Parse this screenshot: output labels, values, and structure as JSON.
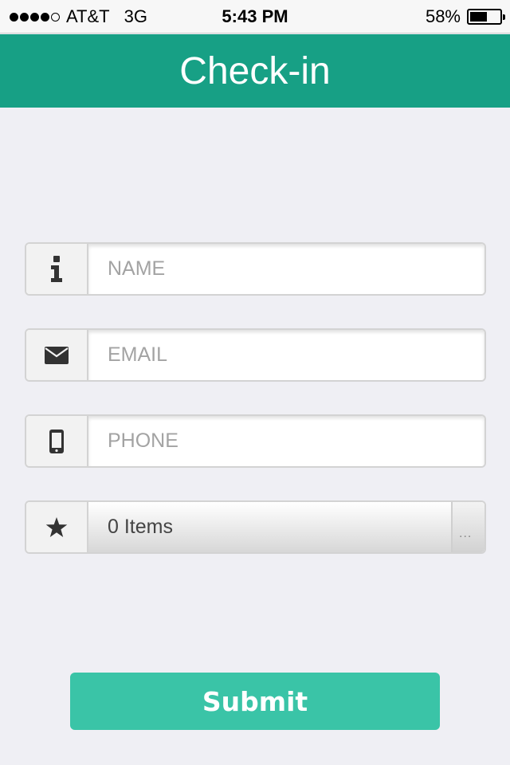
{
  "status_bar": {
    "carrier": "AT&T",
    "network": "3G",
    "time": "5:43 PM",
    "battery": "58%",
    "battery_level": 0.58,
    "signal_bars": 4,
    "signal_total": 5
  },
  "header": {
    "title": "Check-in"
  },
  "form": {
    "name_placeholder": "NAME",
    "email_placeholder": "EMAIL",
    "phone_placeholder": "PHONE",
    "items_value": "0 Items",
    "items_more": "...",
    "submit_label": "Submit"
  },
  "icons": {
    "name": "info-icon",
    "email": "envelope-icon",
    "phone": "mobile-phone-icon",
    "items": "star-icon"
  },
  "colors": {
    "header": "#17a085",
    "submit": "#3ac4a7",
    "background": "#efeff4"
  }
}
